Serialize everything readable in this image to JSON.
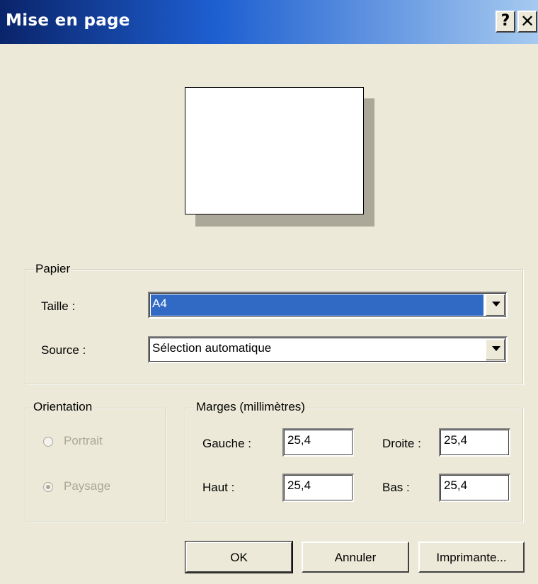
{
  "window": {
    "title": "Mise en page",
    "help_button": "?",
    "close_button": "✕"
  },
  "paper": {
    "legend": "Papier",
    "size_label": "Taille :",
    "size_value": "A4",
    "source_label": "Source :",
    "source_value": "Sélection automatique"
  },
  "orientation": {
    "legend": "Orientation",
    "portrait_label": "Portrait",
    "landscape_label": "Paysage",
    "selected": "Paysage"
  },
  "margins": {
    "legend": "Marges (millimètres)",
    "left_label": "Gauche :",
    "left_value": "25,4",
    "right_label": "Droite :",
    "right_value": "25,4",
    "top_label": "Haut :",
    "top_value": "25,4",
    "bottom_label": "Bas :",
    "bottom_value": "25,4"
  },
  "buttons": {
    "ok": "OK",
    "cancel": "Annuler",
    "printer": "Imprimante..."
  },
  "colors": {
    "dialog_bg": "#ece9d8",
    "titlebar_start": "#0a246a",
    "selection": "#316ac5",
    "disabled_text": "#aca899"
  }
}
